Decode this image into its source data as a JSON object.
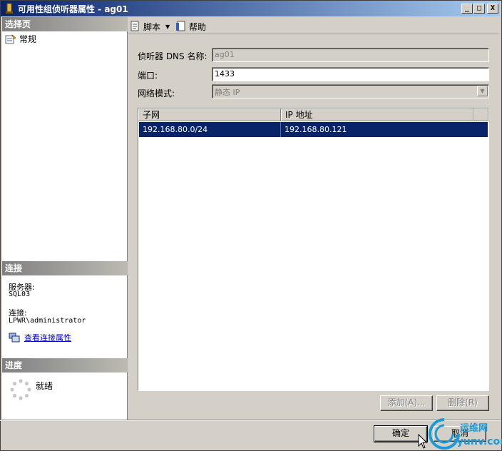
{
  "window": {
    "title": "可用性组侦听器属性 - ag01"
  },
  "titlebar_buttons": {
    "minimize": "_",
    "maximize": "□",
    "close": "X"
  },
  "left": {
    "select_page_header": "选择页",
    "pages": [
      {
        "label": "常规",
        "icon": "page-settings-icon"
      }
    ],
    "connection_header": "连接",
    "server_label": "服务器:",
    "server_value": "SQL03",
    "connection_label": "连接:",
    "connection_value": "LPWR\\administrator",
    "view_connection_link": "查看连接属性",
    "progress_header": "进度",
    "progress_status": "就绪"
  },
  "toolbar": {
    "script_label": "脚本",
    "help_label": "帮助"
  },
  "form": {
    "dns_name_label": "侦听器 DNS 名称:",
    "dns_name_value": "ag01",
    "port_label": "端口:",
    "port_value": "1433",
    "network_mode_label": "网络模式:",
    "network_mode_value": "静态 IP"
  },
  "grid": {
    "columns": [
      "子网",
      "IP 地址"
    ],
    "rows": [
      [
        "192.168.80.0/24",
        "192.168.80.121"
      ]
    ]
  },
  "grid_buttons": {
    "add": "添加(A)...",
    "remove": "删除(R)"
  },
  "footer": {
    "ok": "确定",
    "cancel": "取消"
  },
  "watermark": {
    "text": "运维网",
    "url": "iyunv.com"
  }
}
